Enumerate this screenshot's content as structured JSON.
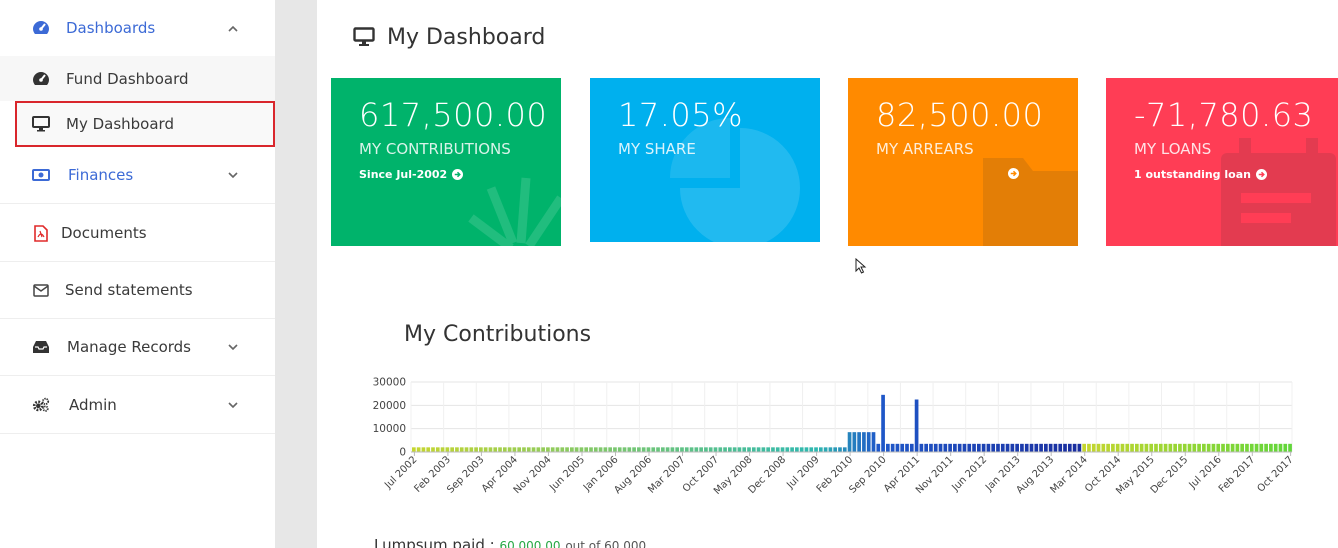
{
  "sidebar": {
    "items": [
      {
        "label": "Dashboards",
        "icon": "dashboard-icon"
      },
      {
        "label": "Fund Dashboard",
        "icon": "speedometer-icon"
      },
      {
        "label": "My Dashboard",
        "icon": "monitor-icon"
      },
      {
        "label": "Finances",
        "icon": "money-icon"
      },
      {
        "label": "Documents",
        "icon": "pdf-file-icon"
      },
      {
        "label": "Send statements",
        "icon": "envelope-icon"
      },
      {
        "label": "Manage Records",
        "icon": "inbox-icon"
      },
      {
        "label": "Admin",
        "icon": "cogs-icon"
      }
    ]
  },
  "page": {
    "title": "My Dashboard"
  },
  "cards": [
    {
      "value": "617,500.00",
      "caption": "MY CONTRIBUTIONS",
      "link": "Since Jul-2002",
      "color": "#00b36b"
    },
    {
      "value": "17.05%",
      "caption": "MY SHARE",
      "link": "",
      "color": "#00b0ee"
    },
    {
      "value": "82,500.00",
      "caption": "MY ARREARS",
      "link": "",
      "color": "#ff8a00"
    },
    {
      "value": "-71,780.63",
      "caption": "MY LOANS",
      "link": "1 outstanding loan",
      "color": "#ff3d55"
    }
  ],
  "chart_title": "My Contributions",
  "chart_data": {
    "type": "bar",
    "yticks": [
      0,
      10000,
      20000,
      30000
    ],
    "ylim": [
      0,
      30000
    ],
    "grid": true,
    "xtick_labels": [
      "Jul 2002",
      "Feb 2003",
      "Sep 2003",
      "Apr 2004",
      "Nov 2004",
      "Jun 2005",
      "Jan 2006",
      "Aug 2006",
      "Mar 2007",
      "Oct 2007",
      "May 2008",
      "Dec 2008",
      "Jul 2009",
      "Feb 2010",
      "Sep 2010",
      "Apr 2011",
      "Nov 2011",
      "Jun 2012",
      "Jan 2013",
      "Aug 2013",
      "Mar 2014",
      "Oct 2014",
      "May 2015",
      "Dec 2015",
      "Jul 2016",
      "Feb 2017",
      "Oct 2017"
    ],
    "segments": [
      {
        "from": "Jul 2002",
        "to": "Jul 2009",
        "monthly_value": 2000
      },
      {
        "from": "Aug 2009",
        "to": "Jan 2010",
        "monthly_value": 2000
      },
      {
        "from": "Feb 2010",
        "to": "Jul 2010",
        "monthly_value": 8500
      },
      {
        "from": "Aug 2010",
        "to": "Oct 2017",
        "monthly_value": 3500
      }
    ],
    "spikes": [
      {
        "month": "Sep 2010",
        "value": 24500
      },
      {
        "month": "Apr 2011",
        "value": 22500
      }
    ],
    "colors": {
      "start": "#c5d62f",
      "mid": "#2eb8b0",
      "blue": "#1f58c9",
      "dark": "#1a2fa0",
      "end": "#5fd63a"
    }
  },
  "lumpsum": {
    "label": "Lumpsum paid :",
    "paid": "60,000.00",
    "out_of": "out of 60,000"
  }
}
